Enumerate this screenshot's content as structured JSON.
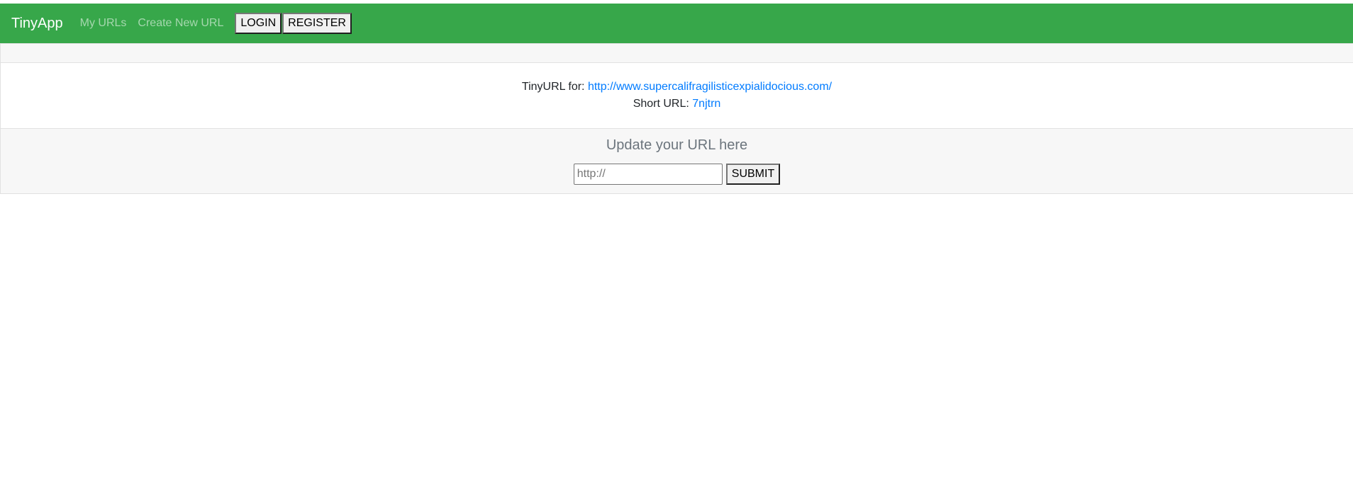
{
  "navbar": {
    "brand": "TinyApp",
    "links": [
      "My URLs",
      "Create New URL"
    ],
    "login_label": "LOGIN",
    "register_label": "REGISTER"
  },
  "url_info": {
    "tinyurl_prefix": "TinyURL for: ",
    "long_url": "http://www.supercalifragilisticexpialidocious.com/",
    "short_prefix": "Short URL: ",
    "short_url": "7njtrn"
  },
  "update": {
    "title": "Update your URL here",
    "placeholder": "http://",
    "value": "",
    "submit_label": "SUBMIT"
  },
  "colors": {
    "navbar_bg": "#37a74a",
    "link": "#007bff",
    "card_bg": "#f7f7f7"
  }
}
